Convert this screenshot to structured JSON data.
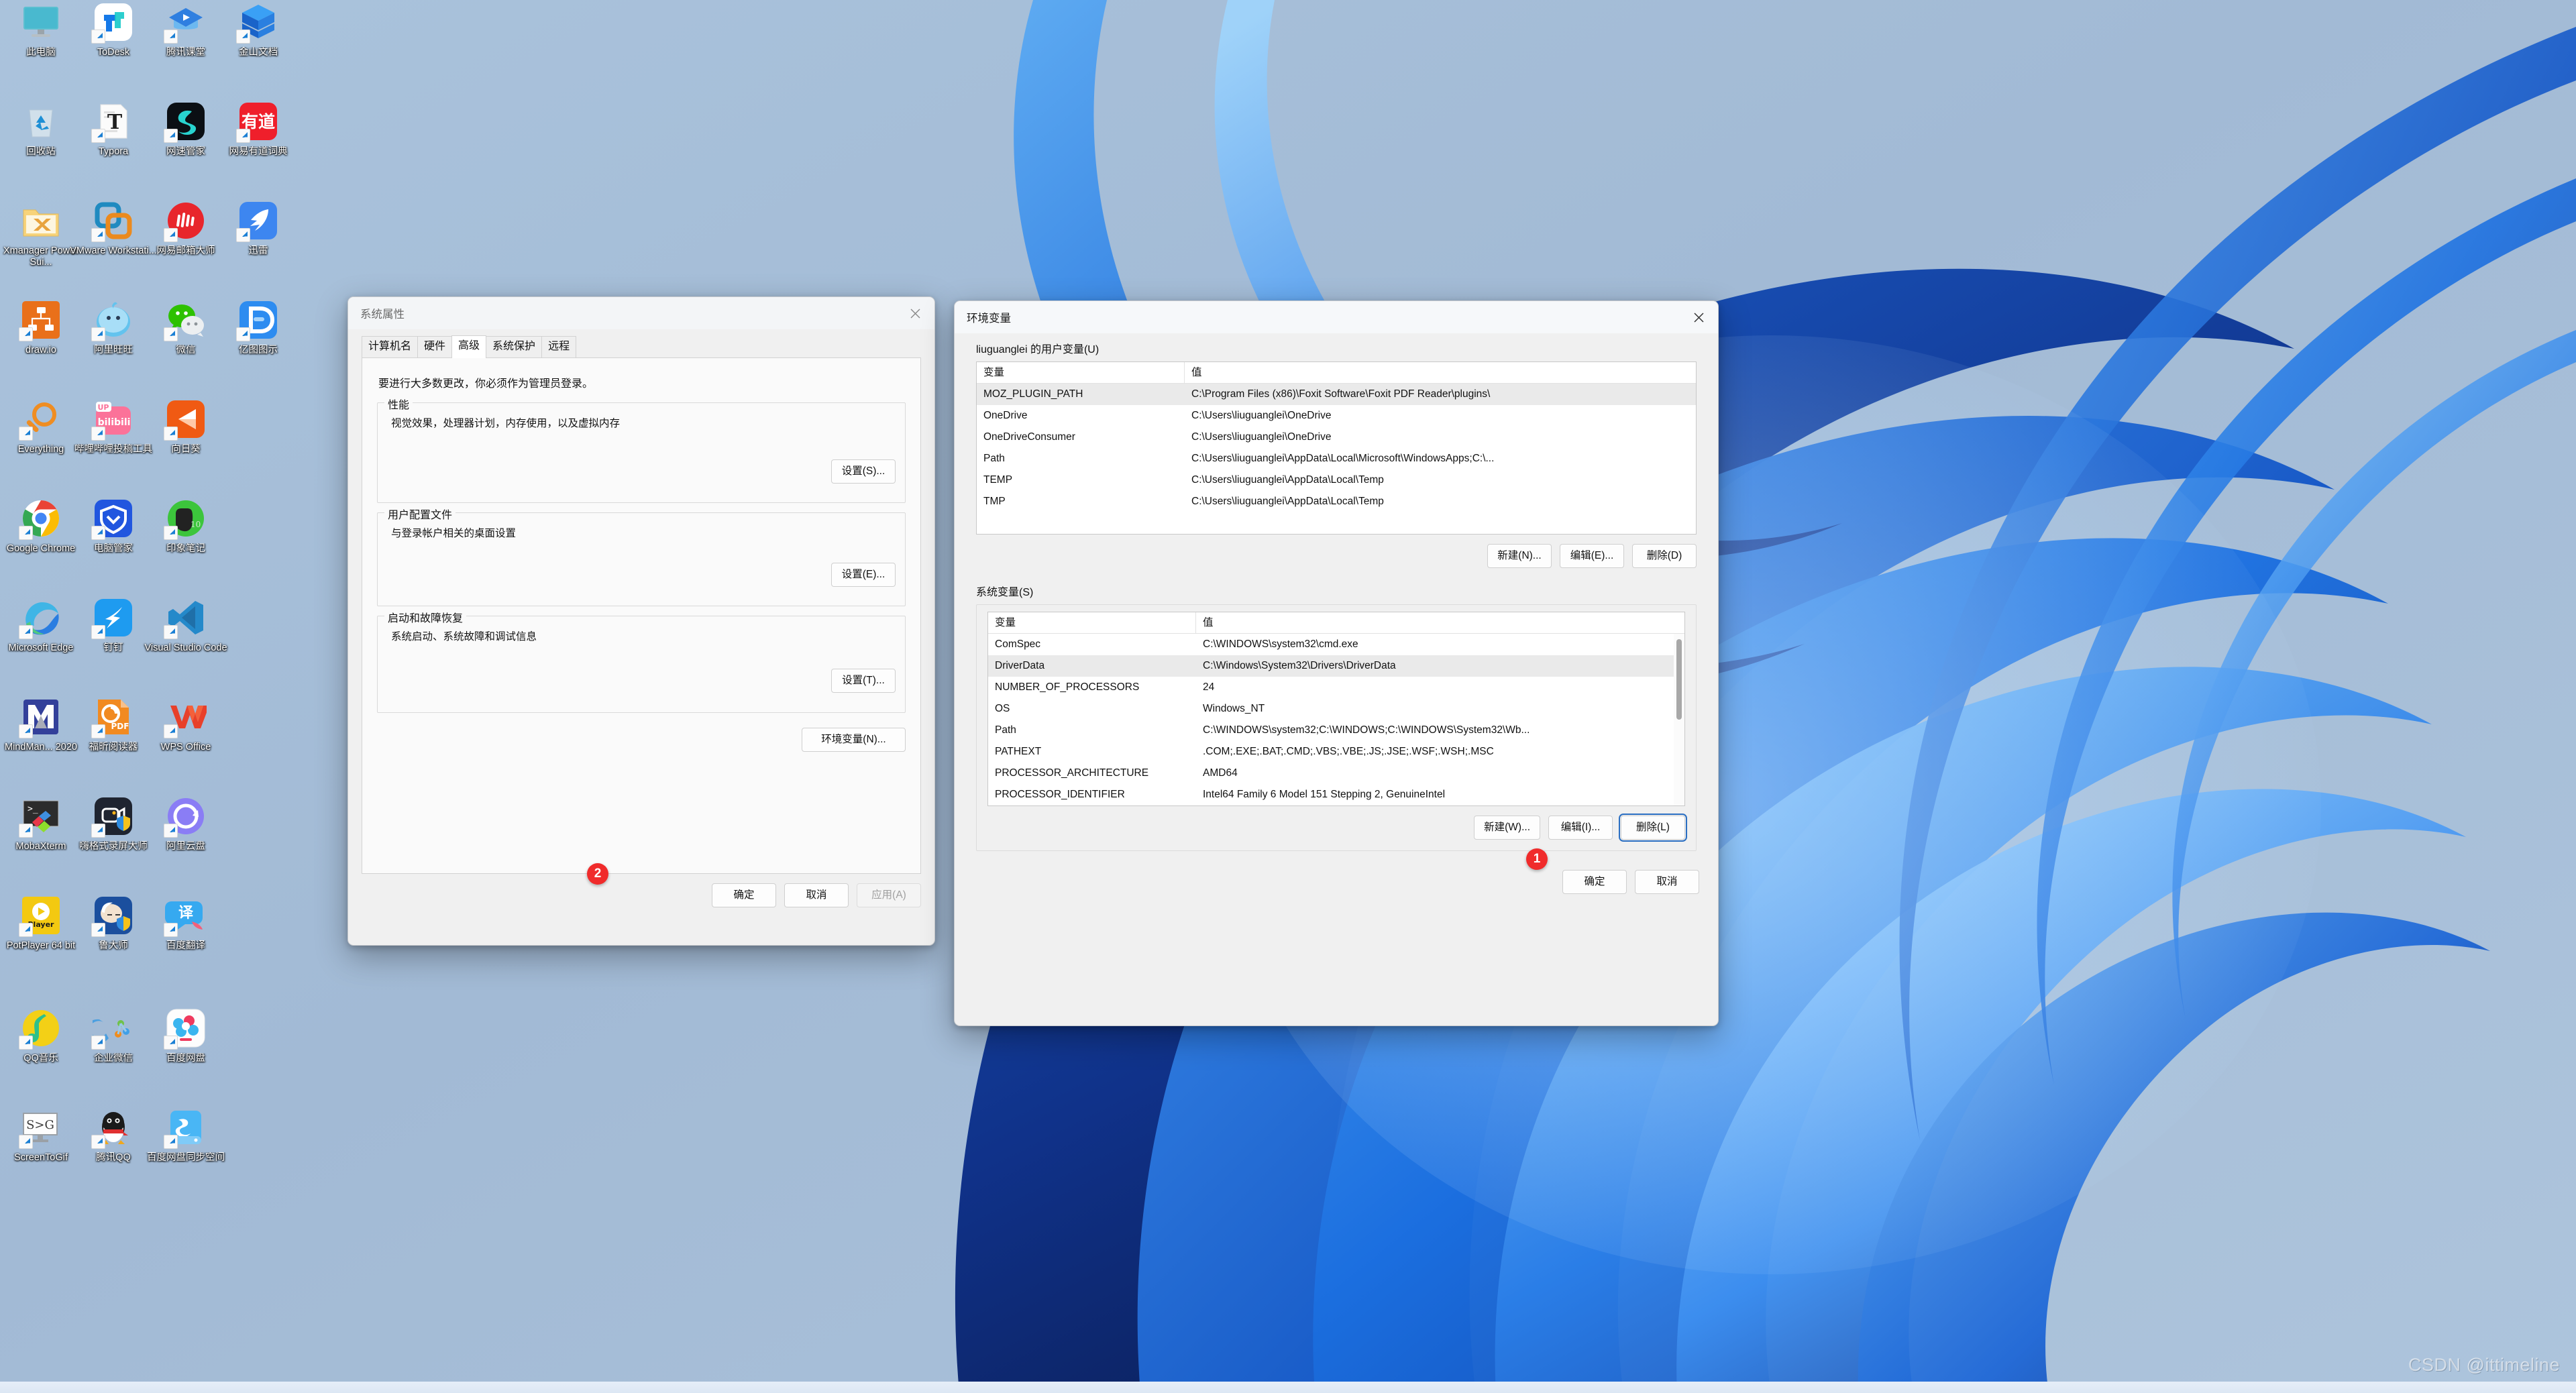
{
  "desktop": {
    "watermark": "CSDN @ittimeline",
    "icons": [
      {
        "label": "此电脑",
        "icon": "this-pc-icon",
        "shortcut": false,
        "kind": "monitor"
      },
      {
        "label": "ToDesk",
        "icon": "todesk-icon",
        "shortcut": true,
        "kind": "todesk"
      },
      {
        "label": "腾讯课堂",
        "icon": "tencent-classroom-icon",
        "shortcut": true,
        "kind": "classroom"
      },
      {
        "label": "金山文档",
        "icon": "kingsoft-docs-icon",
        "shortcut": true,
        "kind": "kdocs"
      },
      {
        "label": "回收站",
        "icon": "recycle-bin-icon",
        "shortcut": false,
        "kind": "recycle"
      },
      {
        "label": "Typora",
        "icon": "typora-icon",
        "shortcut": true,
        "kind": "typora"
      },
      {
        "label": "网速管家",
        "icon": "netspeed-icon",
        "shortcut": true,
        "kind": "netspeed"
      },
      {
        "label": "网易有道词典",
        "icon": "youdao-dict-icon",
        "shortcut": true,
        "kind": "youdao"
      },
      {
        "label": "Xmanager Power Sui...",
        "icon": "xmanager-folder-icon",
        "shortcut": false,
        "kind": "xmanager"
      },
      {
        "label": "VMware Workstati...",
        "icon": "vmware-icon",
        "shortcut": true,
        "kind": "vmware"
      },
      {
        "label": "网易邮箱大师",
        "icon": "netease-mail-icon",
        "shortcut": true,
        "kind": "neteasemail"
      },
      {
        "label": "迅雷",
        "icon": "thunder-icon",
        "shortcut": true,
        "kind": "thunder"
      },
      {
        "label": "draw.io",
        "icon": "drawio-icon",
        "shortcut": true,
        "kind": "drawio"
      },
      {
        "label": "阿里旺旺",
        "icon": "aliwangwang-icon",
        "shortcut": true,
        "kind": "wangwang"
      },
      {
        "label": "微信",
        "icon": "wechat-icon",
        "shortcut": true,
        "kind": "wechat"
      },
      {
        "label": "亿图图示",
        "icon": "edraw-icon",
        "shortcut": true,
        "kind": "edraw"
      },
      {
        "label": "Everything",
        "icon": "everything-icon",
        "shortcut": true,
        "kind": "everything"
      },
      {
        "label": "哔哩哔哩投稿工具",
        "icon": "bilibili-upload-icon",
        "shortcut": true,
        "kind": "bilibili"
      },
      {
        "label": "向日葵",
        "icon": "sunflower-icon",
        "shortcut": true,
        "kind": "sunflower"
      },
      {
        "label": "Google Chrome",
        "icon": "chrome-icon",
        "shortcut": true,
        "kind": "chrome"
      },
      {
        "label": "电脑管家",
        "icon": "pc-manager-icon",
        "shortcut": true,
        "kind": "pcmanager"
      },
      {
        "label": "印象笔记",
        "icon": "evernote-icon",
        "shortcut": true,
        "kind": "evernote"
      },
      {
        "label": "Microsoft Edge",
        "icon": "edge-icon",
        "shortcut": true,
        "kind": "edge"
      },
      {
        "label": "钉钉",
        "icon": "dingtalk-icon",
        "shortcut": true,
        "kind": "dingtalk"
      },
      {
        "label": "Visual Studio Code",
        "icon": "vscode-icon",
        "shortcut": true,
        "kind": "vscode"
      },
      {
        "label": "MindMan... 2020",
        "icon": "mindmanager-icon",
        "shortcut": true,
        "kind": "mindmanager"
      },
      {
        "label": "福昕阅读器",
        "icon": "foxit-reader-icon",
        "shortcut": true,
        "kind": "foxit"
      },
      {
        "label": "WPS Office",
        "icon": "wps-office-icon",
        "shortcut": true,
        "kind": "wps"
      },
      {
        "label": "MobaXterm",
        "icon": "mobaxterm-icon",
        "shortcut": true,
        "kind": "mobaxterm"
      },
      {
        "label": "嗨格式录屏大师",
        "icon": "higeshi-recorder-icon",
        "shortcut": true,
        "kind": "higeshi"
      },
      {
        "label": "阿里云盘",
        "icon": "aliyun-drive-icon",
        "shortcut": true,
        "kind": "aliyundrive"
      },
      {
        "label": "PotPlayer 64 bit",
        "icon": "potplayer-icon",
        "shortcut": true,
        "kind": "potplayer"
      },
      {
        "label": "鲁大师",
        "icon": "ludashi-icon",
        "shortcut": true,
        "kind": "ludashi"
      },
      {
        "label": "百度翻译",
        "icon": "baidu-translate-icon",
        "shortcut": true,
        "kind": "baidutranslate"
      },
      {
        "label": "QQ音乐",
        "icon": "qq-music-icon",
        "shortcut": true,
        "kind": "qqmusic"
      },
      {
        "label": "企业微信",
        "icon": "wecom-icon",
        "shortcut": true,
        "kind": "wecom"
      },
      {
        "label": "百度网盘",
        "icon": "baidu-netdisk-icon",
        "shortcut": true,
        "kind": "baidunetdisk"
      },
      {
        "label": "ScreenToGif",
        "icon": "screentogif-icon",
        "shortcut": true,
        "kind": "screentogif"
      },
      {
        "label": "腾讯QQ",
        "icon": "tencent-qq-icon",
        "shortcut": true,
        "kind": "qq"
      },
      {
        "label": "百度网盘同步空间",
        "icon": "baidu-sync-icon",
        "shortcut": true,
        "kind": "baidusync"
      }
    ]
  },
  "system_properties": {
    "title": "系统属性",
    "close_label": "✕",
    "tabs": [
      {
        "label": "计算机名",
        "selected": false
      },
      {
        "label": "硬件",
        "selected": false
      },
      {
        "label": "高级",
        "selected": true
      },
      {
        "label": "系统保护",
        "selected": false
      },
      {
        "label": "远程",
        "selected": false
      }
    ],
    "admin_hint": "要进行大多数更改，你必须作为管理员登录。",
    "groups": [
      {
        "title": "性能",
        "desc": "视觉效果，处理器计划，内存使用，以及虚拟内存",
        "button": "设置(S)..."
      },
      {
        "title": "用户配置文件",
        "desc": "与登录帐户相关的桌面设置",
        "button": "设置(E)..."
      },
      {
        "title": "启动和故障恢复",
        "desc": "系统启动、系统故障和调试信息",
        "button": "设置(T)..."
      }
    ],
    "env_button": "环境变量(N)...",
    "footer": {
      "ok": "确定",
      "cancel": "取消",
      "apply": "应用(A)",
      "apply_disabled": true
    },
    "badge": "2"
  },
  "environment_variables": {
    "title": "环境变量",
    "close_label": "✕",
    "user_section": {
      "legend": "liuguanglei 的用户变量(U)",
      "columns": [
        "变量",
        "值"
      ],
      "rows": [
        {
          "name": "MOZ_PLUGIN_PATH",
          "value": "C:\\Program Files (x86)\\Foxit Software\\Foxit PDF Reader\\plugins\\",
          "selected": true
        },
        {
          "name": "OneDrive",
          "value": "C:\\Users\\liuguanglei\\OneDrive",
          "selected": false
        },
        {
          "name": "OneDriveConsumer",
          "value": "C:\\Users\\liuguanglei\\OneDrive",
          "selected": false
        },
        {
          "name": "Path",
          "value": "C:\\Users\\liuguanglei\\AppData\\Local\\Microsoft\\WindowsApps;C:\\...",
          "selected": false
        },
        {
          "name": "TEMP",
          "value": "C:\\Users\\liuguanglei\\AppData\\Local\\Temp",
          "selected": false
        },
        {
          "name": "TMP",
          "value": "C:\\Users\\liuguanglei\\AppData\\Local\\Temp",
          "selected": false
        }
      ],
      "buttons": {
        "new": "新建(N)...",
        "edit": "编辑(E)...",
        "delete": "删除(D)"
      }
    },
    "system_section": {
      "legend": "系统变量(S)",
      "columns": [
        "变量",
        "值"
      ],
      "rows": [
        {
          "name": "ComSpec",
          "value": "C:\\WINDOWS\\system32\\cmd.exe",
          "selected": false
        },
        {
          "name": "DriverData",
          "value": "C:\\Windows\\System32\\Drivers\\DriverData",
          "selected": true
        },
        {
          "name": "NUMBER_OF_PROCESSORS",
          "value": "24",
          "selected": false
        },
        {
          "name": "OS",
          "value": "Windows_NT",
          "selected": false
        },
        {
          "name": "Path",
          "value": "C:\\WINDOWS\\system32;C:\\WINDOWS;C:\\WINDOWS\\System32\\Wb...",
          "selected": false
        },
        {
          "name": "PATHEXT",
          "value": ".COM;.EXE;.BAT;.CMD;.VBS;.VBE;.JS;.JSE;.WSF;.WSH;.MSC",
          "selected": false
        },
        {
          "name": "PROCESSOR_ARCHITECTURE",
          "value": "AMD64",
          "selected": false
        },
        {
          "name": "PROCESSOR_IDENTIFIER",
          "value": "Intel64 Family 6 Model 151 Stepping 2, GenuineIntel",
          "selected": false
        }
      ],
      "buttons": {
        "new": "新建(W)...",
        "edit": "编辑(I)...",
        "delete": "删除(L)"
      }
    },
    "footer": {
      "ok": "确定",
      "cancel": "取消"
    },
    "badge": "1"
  },
  "colors": {
    "accent_blue": "#2b6fc2",
    "badge_red": "#f02b2b",
    "dialog_bg": "#f0f0f0",
    "panel_bg": "#fafafa",
    "selection_gray": "#eaeaea",
    "desktop_blue": "#a4bcd6"
  }
}
